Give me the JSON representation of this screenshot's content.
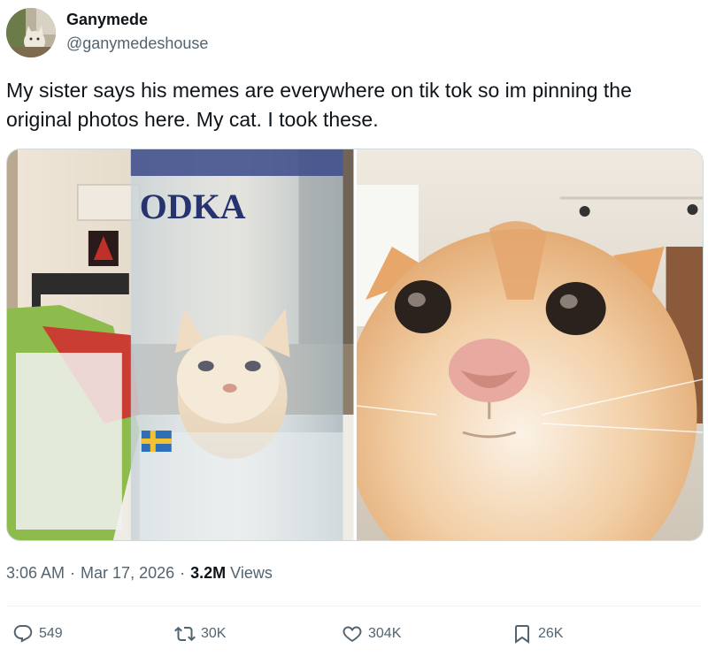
{
  "author": {
    "display_name": "Ganymede",
    "handle": "@ganymedeshouse"
  },
  "tweet": {
    "text": "My sister says his memes are everywhere on tik tok so im pinning the original photos here. My cat. I took these."
  },
  "media": {
    "photos": [
      {
        "icon": "cat-behind-vodka-bottle-photo",
        "bottle_text": "ODKA"
      },
      {
        "icon": "cat-closeup-face-photo"
      }
    ]
  },
  "meta": {
    "time": "3:06 AM",
    "date": "Mar 17, 2026",
    "separator": "·",
    "views_count": "3.2M",
    "views_label": "Views"
  },
  "actions": {
    "replies": "549",
    "reposts": "30K",
    "likes": "304K",
    "bookmarks": "26K"
  },
  "colors": {
    "text_primary": "#0f1419",
    "text_secondary": "#536471",
    "border": "#cfd9de",
    "divider": "#eff3f4"
  },
  "icons": [
    "reply-icon",
    "repost-icon",
    "like-icon",
    "bookmark-icon"
  ]
}
